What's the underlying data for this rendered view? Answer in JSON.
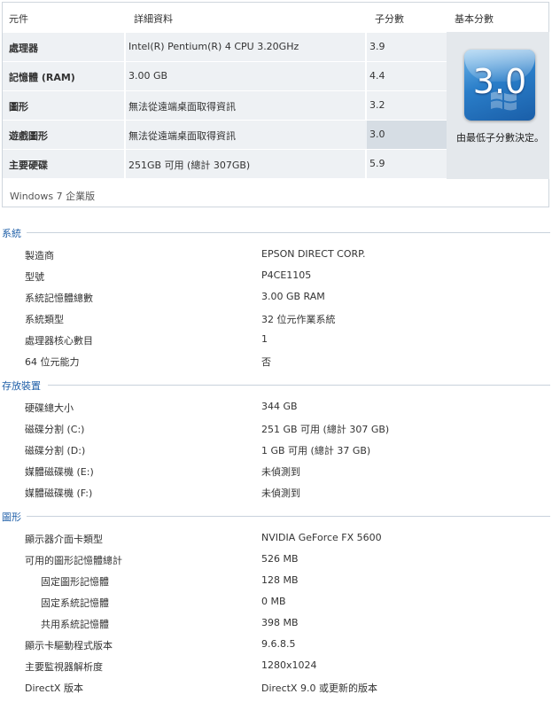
{
  "score_table": {
    "headers": {
      "component": "元件",
      "details": "詳細資料",
      "subscore": "子分數",
      "base_score": "基本分數"
    },
    "rows": [
      {
        "component": "處理器",
        "details": "Intel(R) Pentium(R) 4 CPU 3.20GHz",
        "subscore": "3.9"
      },
      {
        "component": "記憶體 (RAM)",
        "details": "3.00 GB",
        "subscore": "4.4"
      },
      {
        "component": "圖形",
        "details": "無法從遠端桌面取得資訊",
        "subscore": "3.2"
      },
      {
        "component": "遊戲圖形",
        "details": "無法從遠端桌面取得資訊",
        "subscore": "3.0"
      },
      {
        "component": "主要硬碟",
        "details": "251GB 可用 (總計 307GB)",
        "subscore": "5.9"
      }
    ],
    "base_score_value": "3.0",
    "base_score_description": "由最低子分數決定。",
    "edition": "Windows 7 企業版"
  },
  "sections": {
    "system": {
      "title": "系統",
      "items": [
        {
          "label": "製造商",
          "value": "EPSON DIRECT CORP."
        },
        {
          "label": "型號",
          "value": "P4CE1105"
        },
        {
          "label": "系統記憶體總數",
          "value": "3.00 GB RAM"
        },
        {
          "label": "系統類型",
          "value": "32 位元作業系統"
        },
        {
          "label": "處理器核心數目",
          "value": "1"
        },
        {
          "label": "64 位元能力",
          "value": "否"
        }
      ]
    },
    "storage": {
      "title": "存放裝置",
      "items": [
        {
          "label": "硬碟總大小",
          "value": "344 GB"
        },
        {
          "label": "磁碟分割 (C:)",
          "value": "251 GB 可用 (總計 307 GB)"
        },
        {
          "label": "磁碟分割 (D:)",
          "value": "1 GB 可用 (總計 37 GB)"
        },
        {
          "label": "媒體磁碟機 (E:)",
          "value": "未偵測到"
        },
        {
          "label": "媒體磁碟機 (F:)",
          "value": "未偵測到"
        }
      ]
    },
    "graphics": {
      "title": "圖形",
      "items": [
        {
          "label": "顯示器介面卡類型",
          "value": "NVIDIA GeForce FX 5600"
        },
        {
          "label": "可用的圖形記憶體總計",
          "value": "526 MB"
        },
        {
          "label": "固定圖形記憶體",
          "value": "128 MB"
        },
        {
          "label": "固定系統記憶體",
          "value": "0 MB"
        },
        {
          "label": "共用系統記憶體",
          "value": "398 MB"
        },
        {
          "label": "顯示卡驅動程式版本",
          "value": "9.6.8.5"
        },
        {
          "label": "主要監視器解析度",
          "value": "1280x1024"
        },
        {
          "label": "DirectX 版本",
          "value": "DirectX 9.0 或更新的版本"
        }
      ]
    }
  },
  "colors": {
    "section_title": "#1f5fa8",
    "row_bg": "#eef1f4",
    "lowest_cell": "#d6dde4",
    "badge": "#2a7ec9"
  },
  "icons": {
    "windows_logo": "windows-flag-icon"
  }
}
